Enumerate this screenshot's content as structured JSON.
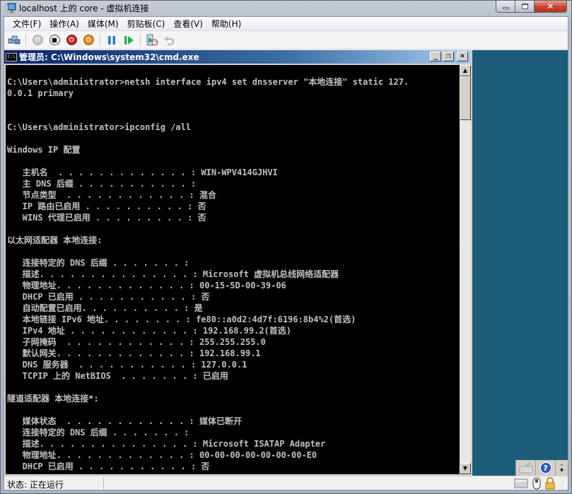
{
  "window": {
    "title": "localhost 上的 core - 虚拟机连接",
    "controls": {
      "minimize": "minimize",
      "maximize": "maximize",
      "close": "close"
    }
  },
  "menubar": {
    "items": [
      {
        "label": "文件(F)"
      },
      {
        "label": "操作(A)"
      },
      {
        "label": "媒体(M)"
      },
      {
        "label": "剪贴板(C)"
      },
      {
        "label": "查看(V)"
      },
      {
        "label": "帮助(H)"
      }
    ]
  },
  "toolbar": {
    "buttons": [
      {
        "icon": "ctrl-alt-del-icon"
      },
      {
        "icon": "start-icon",
        "disabled": true
      },
      {
        "icon": "turn-off-icon"
      },
      {
        "icon": "shutdown-icon"
      },
      {
        "icon": "save-icon"
      },
      {
        "icon": "pause-icon"
      },
      {
        "icon": "resume-icon"
      },
      {
        "icon": "snapshot-icon"
      },
      {
        "icon": "revert-icon",
        "disabled": true
      }
    ]
  },
  "cmd": {
    "title": "管理员: C:\\Windows\\system32\\cmd.exe",
    "icon_text": "C:\\",
    "lines": [
      "",
      "C:\\Users\\administrator>netsh interface ipv4 set dnsserver \"本地连接\" static 127.",
      "0.0.1 primary",
      "",
      "",
      "C:\\Users\\administrator>ipconfig /all",
      "",
      "Windows IP 配置",
      "",
      "   主机名  . . . . . . . . . . . . . : WIN-WPV414GJHVI",
      "   主 DNS 后缀 . . . . . . . . . . . :",
      "   节点类型  . . . . . . . . . . . . : 混合",
      "   IP 路由已启用 . . . . . . . . . . : 否",
      "   WINS 代理已启用 . . . . . . . . . : 否",
      "",
      "以太网适配器 本地连接:",
      "",
      "   连接特定的 DNS 后缀 . . . . . . . :",
      "   描述. . . . . . . . . . . . . . . : Microsoft 虚拟机总线网络适配器",
      "   物理地址. . . . . . . . . . . . . : 00-15-5D-00-39-06",
      "   DHCP 已启用 . . . . . . . . . . . : 否",
      "   自动配置已启用. . . . . . . . . . : 是",
      "   本地链接 IPv6 地址. . . . . . . . : fe80::a0d2:4d7f:6196:8b4%2(首选)",
      "   IPv4 地址 . . . . . . . . . . . . : 192.168.99.2(首选)",
      "   子网掩码  . . . . . . . . . . . . : 255.255.255.0",
      "   默认网关. . . . . . . . . . . . . : 192.168.99.1",
      "   DNS 服务器  . . . . . . . . . . . : 127.0.0.1",
      "   TCPIP 上的 NetBIOS  . . . . . . . : 已启用",
      "",
      "隧道适配器 本地连接*:",
      "",
      "   媒体状态  . . . . . . . . . . . . : 媒体已断开",
      "   连接特定的 DNS 后缀 . . . . . . . :",
      "   描述. . . . . . . . . . . . . . . : Microsoft ISATAP Adapter",
      "   物理地址. . . . . . . . . . . . . : 00-00-00-00-00-00-00-E0",
      "   DHCP 已启用 . . . . . . . . . . . : 否"
    ],
    "controls": {
      "minimize": "_",
      "restore": "❐",
      "close": "×"
    }
  },
  "vm_tools": {
    "keyboard": "keyboard-icon",
    "help": "?",
    "more": "more"
  },
  "statusbar": {
    "status": "状态: 正在运行"
  },
  "colors": {
    "vm_background": "#1b5d78",
    "console_bg": "#000000",
    "console_fg": "#c0c0c0",
    "cmd_title_start": "#0a246a"
  }
}
